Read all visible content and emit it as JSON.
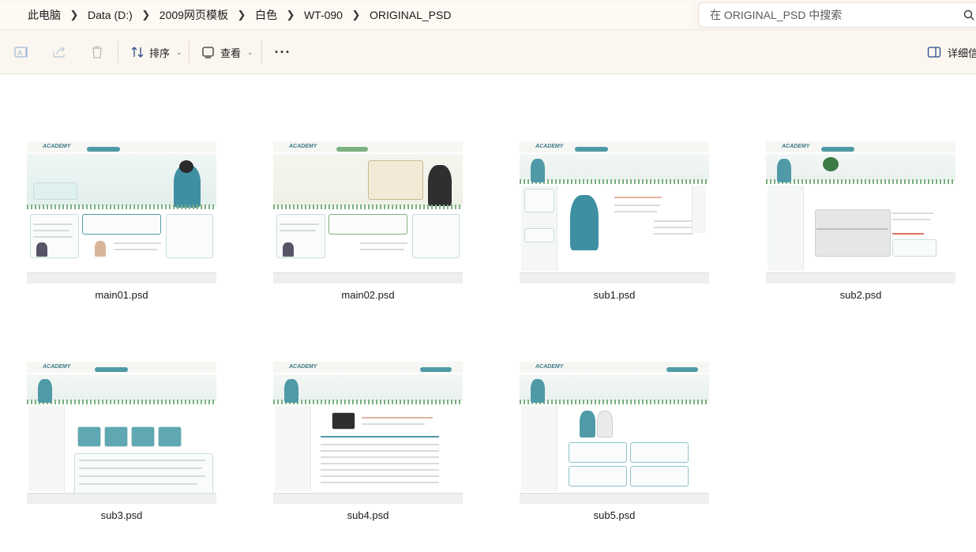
{
  "breadcrumb": {
    "items": [
      "此电脑",
      "Data (D:)",
      "2009网页模板",
      "白色",
      "WT-090",
      "ORIGINAL_PSD"
    ]
  },
  "search": {
    "placeholder": "在 ORIGINAL_PSD 中搜索"
  },
  "toolbar": {
    "rename_icon": "rename-icon",
    "share_icon": "share-icon",
    "delete_icon": "delete-icon",
    "sort_label": "排序",
    "view_label": "查看",
    "more_label": "···",
    "details_label": "详细信息"
  },
  "colors": {
    "chrome_bg": "#fbf6ef",
    "accent_teal": "#4f9aa6",
    "accent_green": "#7bb07f"
  },
  "files": [
    {
      "name": "main01.psd",
      "style": "main-teal"
    },
    {
      "name": "main02.psd",
      "style": "main-green"
    },
    {
      "name": "sub1.psd",
      "style": "sub"
    },
    {
      "name": "sub2.psd",
      "style": "sub-map"
    },
    {
      "name": "sub3.psd",
      "style": "sub-list"
    },
    {
      "name": "sub4.psd",
      "style": "sub-table"
    },
    {
      "name": "sub5.psd",
      "style": "sub-grid"
    }
  ]
}
